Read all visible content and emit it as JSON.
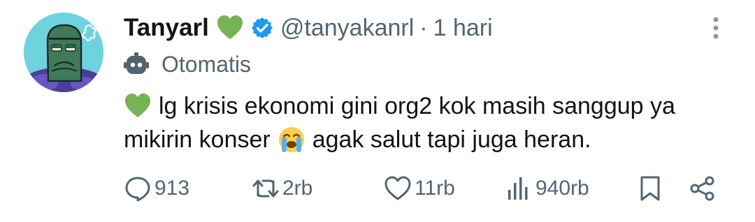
{
  "author": {
    "display_name": "Tanyarl",
    "name_emoji": "green-heart",
    "verified": true,
    "handle": "@tanyakanrl",
    "separator": "·",
    "time": "1 hari"
  },
  "automated_label": "Otomatis",
  "body": {
    "line1_text": "lg krisis ekonomi gini org2 kok masih sanggup ya",
    "line2_before": "mikirin konser",
    "line2_after": "agak salut tapi juga heran.",
    "emojis": [
      "green-heart",
      "loudly-crying-face"
    ]
  },
  "actions": {
    "replies": "913",
    "reposts": "2rb",
    "likes": "11rb",
    "views": "940rb"
  },
  "colors": {
    "text_primary": "#0f1419",
    "text_secondary": "#536471",
    "verified_blue": "#1d9bf0",
    "heart_green": "#77b255"
  }
}
